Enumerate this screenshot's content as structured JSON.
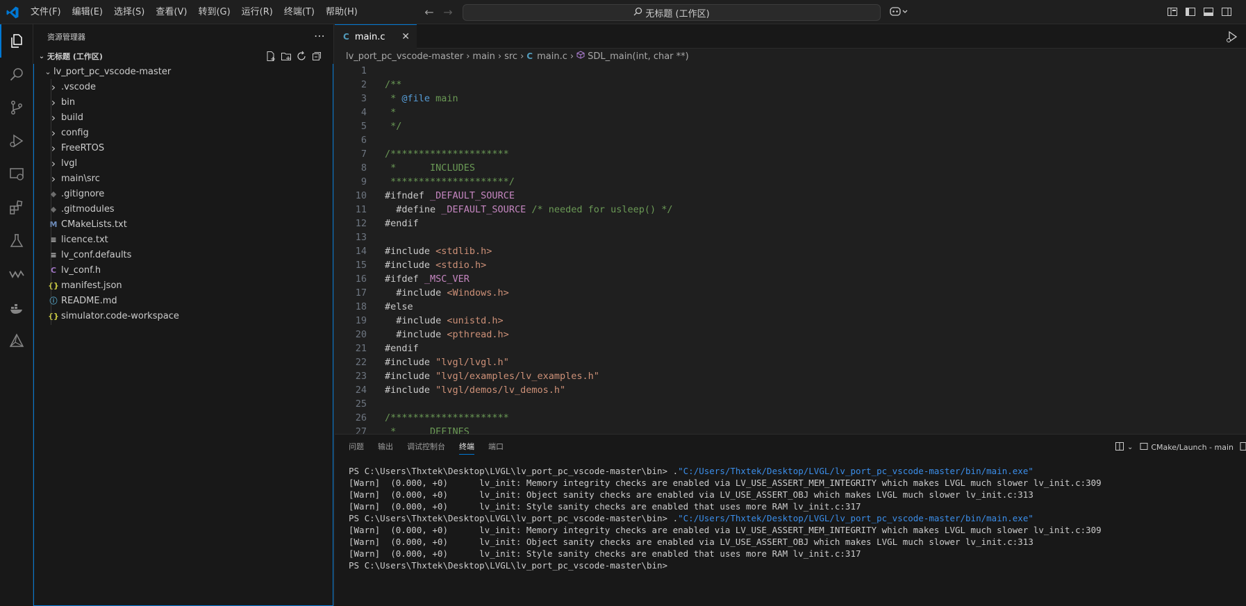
{
  "titlebar": {
    "menu": [
      "文件(F)",
      "编辑(E)",
      "选择(S)",
      "查看(V)",
      "转到(G)",
      "运行(R)",
      "终端(T)",
      "帮助(H)"
    ],
    "command_center": "无标题 (工作区)"
  },
  "sidebar": {
    "title": "资源管理器",
    "workspace": "无标题 (工作区)",
    "root_folder": "lv_port_pc_vscode-master",
    "items": [
      {
        "label": ".vscode",
        "type": "folder"
      },
      {
        "label": "bin",
        "type": "folder"
      },
      {
        "label": "build",
        "type": "folder"
      },
      {
        "label": "config",
        "type": "folder"
      },
      {
        "label": "FreeRTOS",
        "type": "folder"
      },
      {
        "label": "lvgl",
        "type": "folder"
      },
      {
        "label": "main\\src",
        "type": "folder"
      },
      {
        "label": ".gitignore",
        "type": "git"
      },
      {
        "label": ".gitmodules",
        "type": "git"
      },
      {
        "label": "CMakeLists.txt",
        "type": "cmake"
      },
      {
        "label": "licence.txt",
        "type": "text"
      },
      {
        "label": "lv_conf.defaults",
        "type": "text"
      },
      {
        "label": "lv_conf.h",
        "type": "c"
      },
      {
        "label": "manifest.json",
        "type": "json"
      },
      {
        "label": "README.md",
        "type": "info"
      },
      {
        "label": "simulator.code-workspace",
        "type": "json"
      }
    ]
  },
  "editor": {
    "tab_label": "main.c",
    "breadcrumbs": [
      "lv_port_pc_vscode-master",
      "main",
      "src",
      "main.c",
      "SDL_main(int, char **)"
    ]
  },
  "code_lines": [
    {
      "n": "1",
      "parts": []
    },
    {
      "n": "2",
      "parts": [
        {
          "c": "cm",
          "t": "/**"
        }
      ]
    },
    {
      "n": "3",
      "parts": [
        {
          "c": "cm",
          "t": " * "
        },
        {
          "c": "kw",
          "t": "@file"
        },
        {
          "c": "cm",
          "t": " main"
        }
      ]
    },
    {
      "n": "4",
      "parts": [
        {
          "c": "cm",
          "t": " *"
        }
      ]
    },
    {
      "n": "5",
      "parts": [
        {
          "c": "cm",
          "t": " */"
        }
      ]
    },
    {
      "n": "6",
      "parts": []
    },
    {
      "n": "7",
      "parts": [
        {
          "c": "cm",
          "t": "/*********************"
        }
      ]
    },
    {
      "n": "8",
      "parts": [
        {
          "c": "cm",
          "t": " *      INCLUDES"
        }
      ]
    },
    {
      "n": "9",
      "parts": [
        {
          "c": "cm",
          "t": " *********************/"
        }
      ]
    },
    {
      "n": "10",
      "parts": [
        {
          "c": "pp-plain",
          "t": "#ifndef "
        },
        {
          "c": "mac",
          "t": "_DEFAULT_SOURCE"
        }
      ]
    },
    {
      "n": "11",
      "parts": [
        {
          "c": "pp-plain",
          "t": "  #define "
        },
        {
          "c": "mac",
          "t": "_DEFAULT_SOURCE"
        },
        {
          "c": "cm",
          "t": " /* needed for usleep() */"
        }
      ]
    },
    {
      "n": "12",
      "parts": [
        {
          "c": "pp-plain",
          "t": "#endif"
        }
      ]
    },
    {
      "n": "13",
      "parts": []
    },
    {
      "n": "14",
      "parts": [
        {
          "c": "pp-plain",
          "t": "#include "
        },
        {
          "c": "str",
          "t": "<stdlib.h>"
        }
      ]
    },
    {
      "n": "15",
      "parts": [
        {
          "c": "pp-plain",
          "t": "#include "
        },
        {
          "c": "str",
          "t": "<stdio.h>"
        }
      ]
    },
    {
      "n": "16",
      "parts": [
        {
          "c": "pp-plain",
          "t": "#ifdef "
        },
        {
          "c": "mac",
          "t": "_MSC_VER"
        }
      ]
    },
    {
      "n": "17",
      "parts": [
        {
          "c": "pp-plain",
          "t": "  #include "
        },
        {
          "c": "str",
          "t": "<Windows.h>"
        }
      ]
    },
    {
      "n": "18",
      "parts": [
        {
          "c": "pp-plain",
          "t": "#else"
        }
      ]
    },
    {
      "n": "19",
      "parts": [
        {
          "c": "pp-plain",
          "t": "  #include "
        },
        {
          "c": "str",
          "t": "<unistd.h>"
        }
      ]
    },
    {
      "n": "20",
      "parts": [
        {
          "c": "pp-plain",
          "t": "  #include "
        },
        {
          "c": "str",
          "t": "<pthread.h>"
        }
      ]
    },
    {
      "n": "21",
      "parts": [
        {
          "c": "pp-plain",
          "t": "#endif"
        }
      ]
    },
    {
      "n": "22",
      "parts": [
        {
          "c": "pp-plain",
          "t": "#include "
        },
        {
          "c": "str",
          "t": "\"lvgl/lvgl.h\""
        }
      ]
    },
    {
      "n": "23",
      "parts": [
        {
          "c": "pp-plain",
          "t": "#include "
        },
        {
          "c": "str",
          "t": "\"lvgl/examples/lv_examples.h\""
        }
      ]
    },
    {
      "n": "24",
      "parts": [
        {
          "c": "pp-plain",
          "t": "#include "
        },
        {
          "c": "str",
          "t": "\"lvgl/demos/lv_demos.h\""
        }
      ]
    },
    {
      "n": "25",
      "parts": []
    },
    {
      "n": "26",
      "parts": [
        {
          "c": "cm",
          "t": "/*********************"
        }
      ]
    },
    {
      "n": "27",
      "parts": [
        {
          "c": "cm",
          "t": " *      DEFINES"
        }
      ]
    }
  ],
  "panel": {
    "tabs": [
      "问题",
      "输出",
      "调试控制台",
      "终端",
      "端口"
    ],
    "active_tab": "终端",
    "task_label": "CMake/Launch - main"
  },
  "terminal_lines": [
    {
      "prompt": "PS C:\\Users\\Thxtek\\Desktop\\LVGL\\lv_port_pc_vscode-master\\bin> ",
      "cmd_dot": ".",
      "path": "\"C:/Users/Thxtek/Desktop/LVGL/lv_port_pc_vscode-master/bin/main.exe\""
    },
    {
      "text": "[Warn]  (0.000, +0)      lv_init: Memory integrity checks are enabled via LV_USE_ASSERT_MEM_INTEGRITY which makes LVGL much slower lv_init.c:309"
    },
    {
      "text": "[Warn]  (0.000, +0)      lv_init: Object sanity checks are enabled via LV_USE_ASSERT_OBJ which makes LVGL much slower lv_init.c:313"
    },
    {
      "text": "[Warn]  (0.000, +0)      lv_init: Style sanity checks are enabled that uses more RAM lv_init.c:317"
    },
    {
      "prompt": "PS C:\\Users\\Thxtek\\Desktop\\LVGL\\lv_port_pc_vscode-master\\bin> ",
      "cmd_dot": ".",
      "path": "\"C:/Users/Thxtek/Desktop/LVGL/lv_port_pc_vscode-master/bin/main.exe\""
    },
    {
      "text": "[Warn]  (0.000, +0)      lv_init: Memory integrity checks are enabled via LV_USE_ASSERT_MEM_INTEGRITY which makes LVGL much slower lv_init.c:309"
    },
    {
      "text": "[Warn]  (0.000, +0)      lv_init: Object sanity checks are enabled via LV_USE_ASSERT_OBJ which makes LVGL much slower lv_init.c:313"
    },
    {
      "text": "[Warn]  (0.000, +0)      lv_init: Style sanity checks are enabled that uses more RAM lv_init.c:317"
    },
    {
      "text": "PS C:\\Users\\Thxtek\\Desktop\\LVGL\\lv_port_pc_vscode-master\\bin>"
    }
  ],
  "colors": {
    "accent": "#0078d4",
    "comment": "#6a9955",
    "string": "#ce9178",
    "macro": "#c586c0",
    "keyword": "#569cd6",
    "terminal_path": "#3b8eea"
  }
}
